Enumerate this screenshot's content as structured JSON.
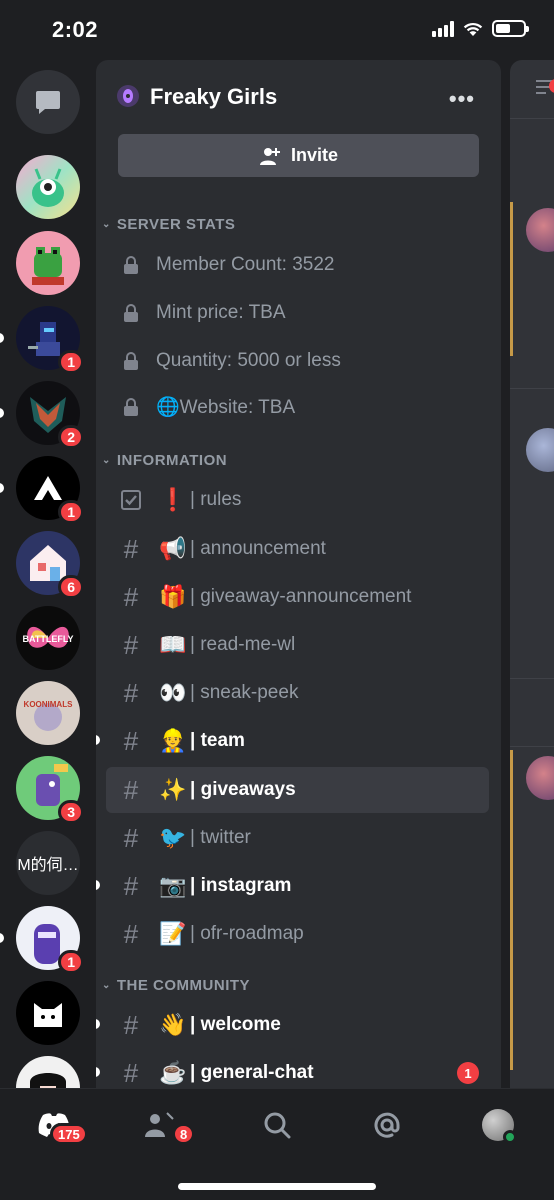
{
  "status_bar": {
    "time": "2:02",
    "battery_level": 0.55
  },
  "server_rail": {
    "servers": [
      {
        "name": "direct-messages",
        "icon": "chat-bubble-icon"
      },
      {
        "name": "alien-server",
        "badge": ""
      },
      {
        "name": "frog-server",
        "badge": ""
      },
      {
        "name": "knight-server",
        "badge": "1"
      },
      {
        "name": "fox-server",
        "badge": "2"
      },
      {
        "name": "a-logo-server",
        "badge": "1"
      },
      {
        "name": "house-server",
        "badge": "6"
      },
      {
        "name": "battlefly-server",
        "label": "BATTLEFLY"
      },
      {
        "name": "koonimals-server",
        "label": "KOONIMALS"
      },
      {
        "name": "dino-server",
        "badge": "3"
      },
      {
        "name": "text-server",
        "label": "M的伺…"
      },
      {
        "name": "ninja-server",
        "badge": "1"
      },
      {
        "name": "cat-server"
      },
      {
        "name": "anime-server"
      }
    ]
  },
  "guild": {
    "name": "Freaky Girls",
    "more": "•••",
    "invite_label": "Invite"
  },
  "categories": {
    "server_stats": "SERVER STATS",
    "information": "INFORMATION",
    "community": "THE COMMUNITY"
  },
  "channels": {
    "stats": [
      {
        "name": "Member Count: 3522"
      },
      {
        "name": "Mint price: TBA"
      },
      {
        "name": "Quantity: 5000 or less"
      },
      {
        "name": "🌐Website: TBA"
      }
    ],
    "info": [
      {
        "emoji": "❗",
        "name": "| rules"
      },
      {
        "emoji": "📢",
        "name": "| announcement"
      },
      {
        "emoji": "🎁",
        "name": "| giveaway-announcement"
      },
      {
        "emoji": "📖",
        "name": "| read-me-wl"
      },
      {
        "emoji": "👀",
        "name": "| sneak-peek"
      },
      {
        "emoji": "👷",
        "name": "| team"
      },
      {
        "emoji": "✨",
        "name": "| giveaways"
      },
      {
        "emoji": "🐦",
        "name": "| twitter"
      },
      {
        "emoji": "📷",
        "name": "| instagram"
      },
      {
        "emoji": "📝",
        "name": "| ofr-roadmap"
      }
    ],
    "community": [
      {
        "emoji": "👋",
        "name": "| welcome"
      },
      {
        "emoji": "☕",
        "name": "| general-chat",
        "badge": "1"
      }
    ]
  },
  "tabbar": {
    "home_badge": "175",
    "friends_badge": "8"
  },
  "colors": {
    "accent_red": "#f23f43",
    "panel": "#2b2d31",
    "rail": "#1e1f22"
  }
}
